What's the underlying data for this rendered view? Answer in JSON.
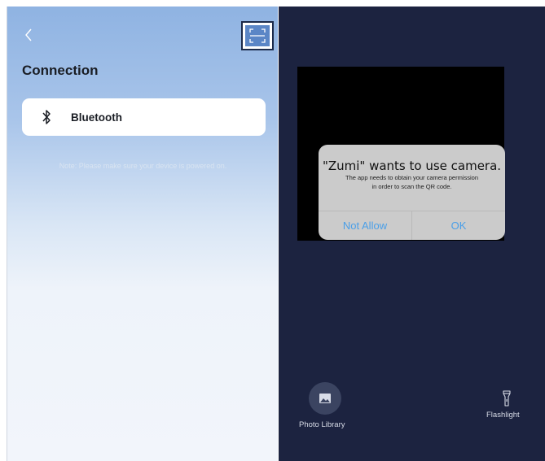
{
  "left_panel": {
    "title": "Connection",
    "bluetooth_label": "Bluetooth",
    "note": "Note: Please make sure your device is powered on.",
    "icons": {
      "back": "chevron-left-icon",
      "scan": "scan-icon",
      "bluetooth": "bluetooth-icon"
    }
  },
  "right_panel": {
    "dialog": {
      "title": "\"Zumi\" wants to use camera.",
      "message_line1": "The app needs to obtain your camera permission",
      "message_line2": "in order to scan the QR code.",
      "not_allow_label": "Not Allow",
      "ok_label": "OK"
    },
    "photo_library_label": "Photo Library",
    "flashlight_label": "Flashlight",
    "icons": {
      "photo": "image-icon",
      "flashlight": "flashlight-icon"
    }
  },
  "colors": {
    "accent_blue": "#4a9fe8",
    "scanner_bg": "#1c2340"
  }
}
